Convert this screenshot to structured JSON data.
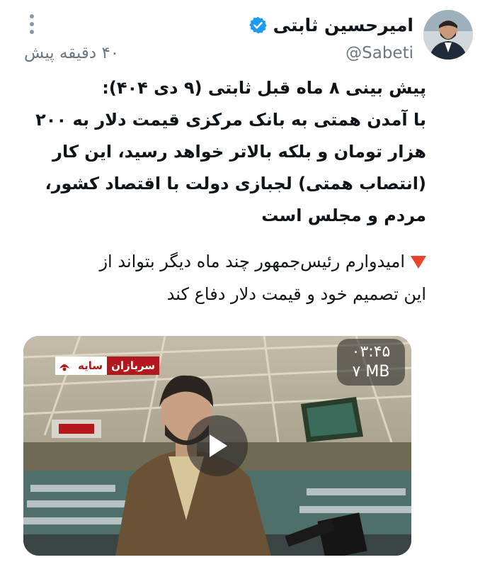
{
  "author": {
    "name": "امیرحسین ثابتی",
    "handle": "@Sabeti",
    "verified_color": "#1d9bf0"
  },
  "post": {
    "time": "۴۰ دقیقه پیش",
    "bold_lines": [
      "پیش بینی ۸ ماه قبل ثابتی (۹ دی ۴۰۴):",
      "با آمدن همتی به بانک مرکزی قیمت دلار به ۲۰۰",
      "هزار تومان و بلکه بالاتر خواهد رسید، این کار",
      "(انتصاب همتی) لجبازی دولت با اقتصاد کشور،",
      "مردم و مجلس است"
    ],
    "normal_lines": [
      "امیدوارم رئیس‌جمهور چند ماه دیگر بتواند از",
      "این تصمیم خود و قیمت دلار دفاع کند"
    ],
    "bullet_icon": "red-down-triangle-icon"
  },
  "video": {
    "duration": "۰۳:۴۵",
    "size": "۷ MB",
    "logo_part1": "سربازان",
    "logo_part2": "سایه",
    "play_icon": "play-icon"
  },
  "colors": {
    "text": "#0f1419",
    "muted": "#6b7780",
    "accent": "#1d9bf0",
    "logo_red": "#b3181d"
  }
}
